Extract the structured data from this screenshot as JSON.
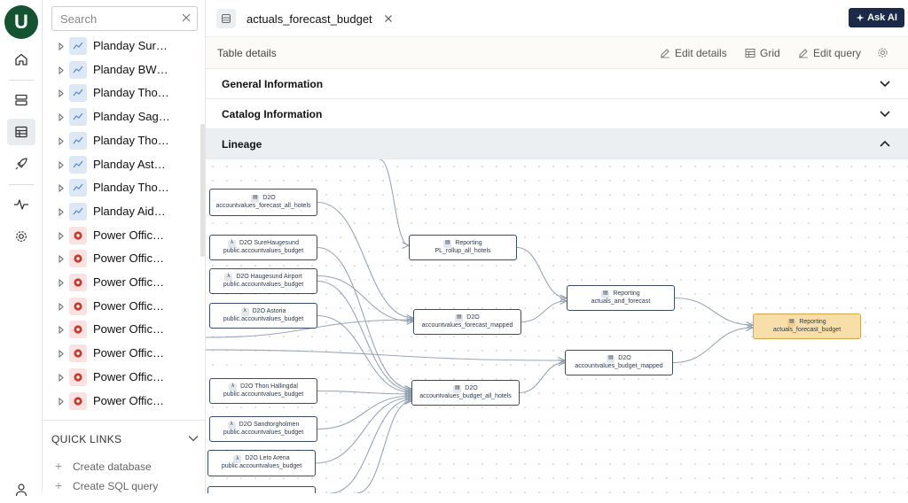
{
  "rail": {
    "logo": "U",
    "icons": [
      "home-icon",
      "database-icon",
      "table-icon",
      "rocket-icon",
      "activity-icon",
      "settings-icon",
      "user-icon"
    ]
  },
  "sidebar": {
    "search_placeholder": "Search",
    "items": [
      {
        "label": "Planday Sur…",
        "icon": "planday-icon"
      },
      {
        "label": "Planday BW…",
        "icon": "planday-icon"
      },
      {
        "label": "Planday Tho…",
        "icon": "planday-icon"
      },
      {
        "label": "Planday Sag…",
        "icon": "planday-icon"
      },
      {
        "label": "Planday Tho…",
        "icon": "planday-icon"
      },
      {
        "label": "Planday Ast…",
        "icon": "planday-icon"
      },
      {
        "label": "Planday Tho…",
        "icon": "planday-icon"
      },
      {
        "label": "Planday Aid…",
        "icon": "planday-icon"
      },
      {
        "label": "Power Offic…",
        "icon": "power-office-icon"
      },
      {
        "label": "Power Offic…",
        "icon": "power-office-icon"
      },
      {
        "label": "Power Offic…",
        "icon": "power-office-icon"
      },
      {
        "label": "Power Offic…",
        "icon": "power-office-icon"
      },
      {
        "label": "Power Offic…",
        "icon": "power-office-icon"
      },
      {
        "label": "Power Offic…",
        "icon": "power-office-icon"
      },
      {
        "label": "Power Offic…",
        "icon": "power-office-icon"
      },
      {
        "label": "Power Offic…",
        "icon": "power-office-icon"
      }
    ],
    "quick_links": {
      "title": "QUICK LINKS",
      "items": [
        "Create database",
        "Create SQL query"
      ]
    }
  },
  "tab": {
    "title": "actuals_forecast_budget"
  },
  "ask_ai": "Ask AI",
  "details": {
    "title": "Table details",
    "actions": {
      "edit_details": "Edit details",
      "grid": "Grid",
      "edit_query": "Edit query"
    }
  },
  "sections": {
    "general": "General Information",
    "catalog": "Catalog Information",
    "lineage": "Lineage"
  },
  "lineage": {
    "nodes": {
      "n1": {
        "l1": "D2O",
        "l2": "accountvalues_forecast_all_hotels",
        "icon": "table-icon"
      },
      "n2": {
        "l1": "D2O SureHaugesund",
        "l2": "public.accountvalues_budget",
        "icon": "lambda-icon"
      },
      "n3": {
        "l1": "D2O Haugesund Airport",
        "l2": "public.accountvalues_budget",
        "icon": "lambda-icon"
      },
      "n4": {
        "l1": "D2O Astoria",
        "l2": "public.accountvalues_budget",
        "icon": "lambda-icon"
      },
      "n5": {
        "l1": "D2O Thon Hallingdal",
        "l2": "public.accountvalues_budget",
        "icon": "lambda-icon"
      },
      "n6": {
        "l1": "D2O Sandtorgholmen",
        "l2": "public.accountvalues_budget",
        "icon": "lambda-icon"
      },
      "n7": {
        "l1": "D2O Leto Arena",
        "l2": "public.accountvalues_budget",
        "icon": "lambda-icon"
      },
      "r1": {
        "l1": "Reporting",
        "l2": "PL_rollup_all_hotels",
        "icon": "table-icon"
      },
      "m1": {
        "l1": "D2O",
        "l2": "accountvalues_forecast_mapped",
        "icon": "table-icon"
      },
      "b1": {
        "l1": "D2O",
        "l2": "accountvalues_budget_all_hotels",
        "icon": "table-icon"
      },
      "af": {
        "l1": "Reporting",
        "l2": "actuals_and_forecast",
        "icon": "table-icon"
      },
      "bm": {
        "l1": "D2O",
        "l2": "accountvalues_budget_mapped",
        "icon": "table-icon"
      },
      "fin": {
        "l1": "Reporting",
        "l2": "actuals_forecast_budget",
        "icon": "table-icon"
      }
    }
  },
  "colors": {
    "brand": "#13532f",
    "ask_ai_bg": "#1b2a49",
    "highlight_node": "#f8dfaa",
    "edge": "#9aa6b6"
  }
}
